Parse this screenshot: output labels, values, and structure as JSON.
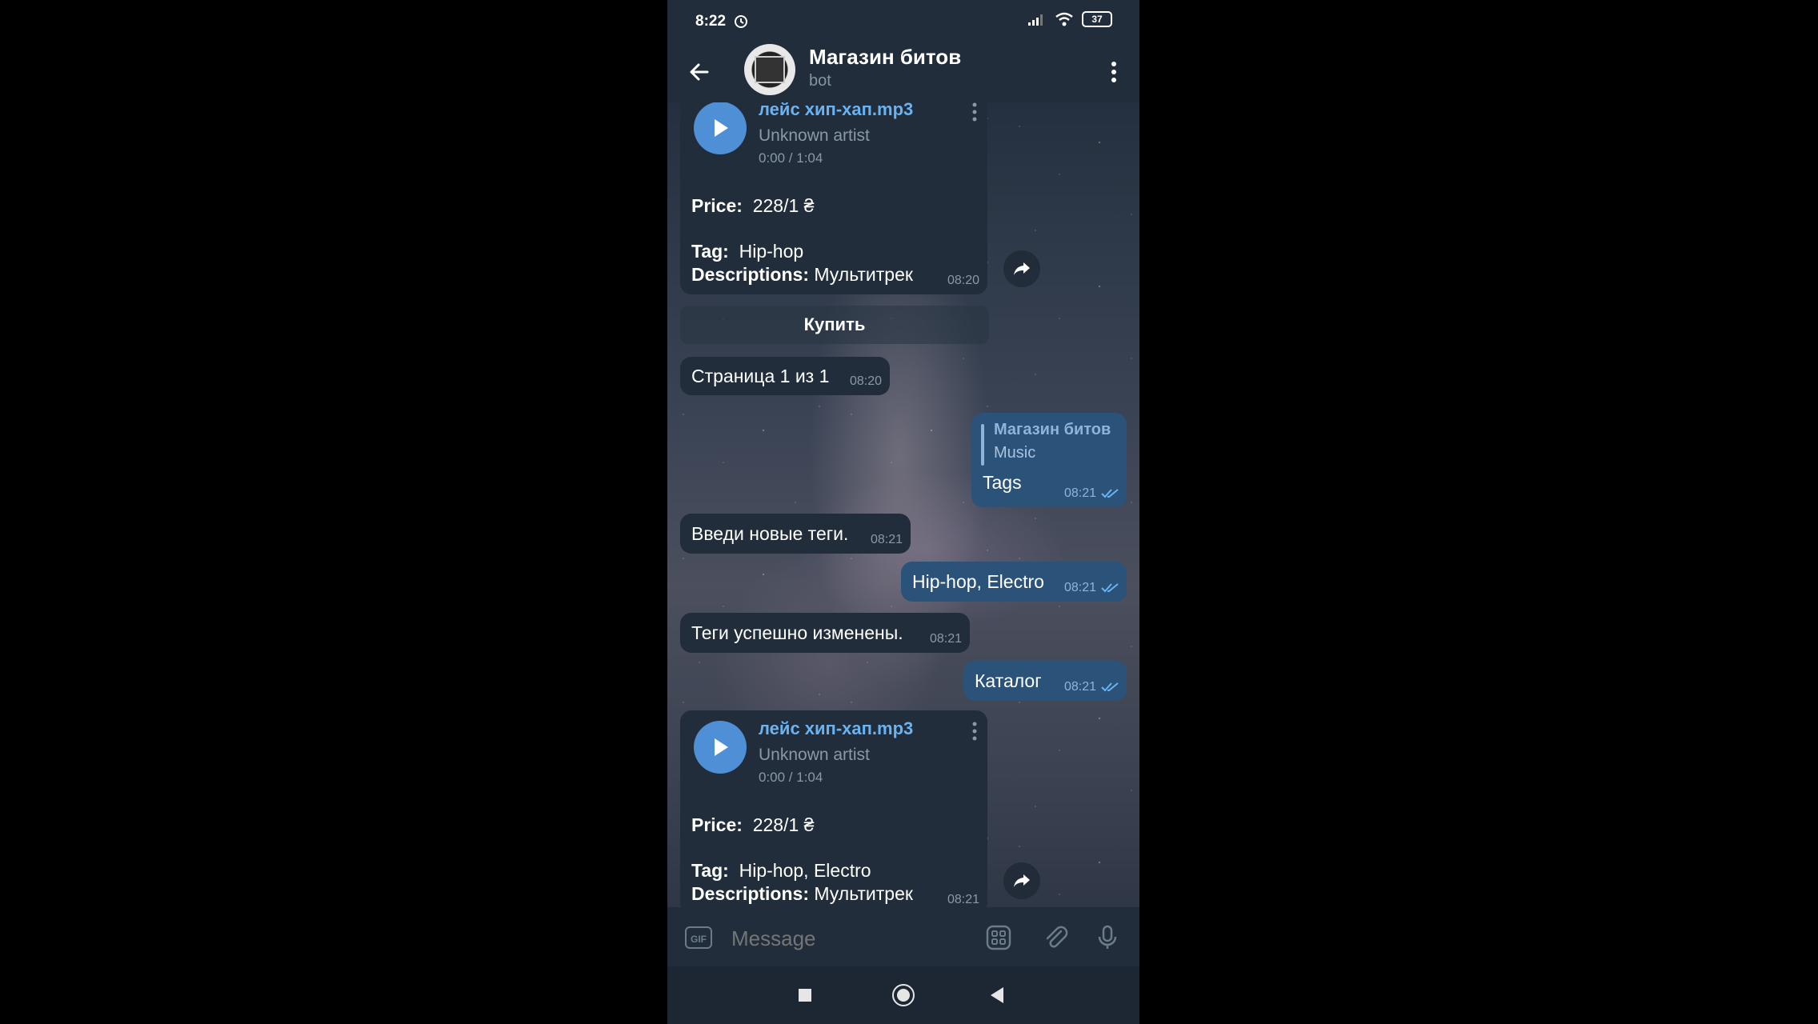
{
  "status": {
    "time": "8:22",
    "battery": "37"
  },
  "header": {
    "title": "Магазин битов",
    "subtitle": "bot"
  },
  "messages": {
    "audio1": {
      "filename": "лейс хип-хап.mp3",
      "artist": "Unknown artist",
      "duration": "0:00 / 1:04",
      "price_label": "Price:",
      "price_value": "228/1 ₴",
      "tag_label": "Tag:",
      "tag_value": "Hip-hop",
      "desc_label": "Descriptions:",
      "desc_value": "Мультитрек",
      "time": "08:20"
    },
    "buy_button": "Купить",
    "page_info": {
      "text": "Страница 1 из 1",
      "time": "08:20"
    },
    "tags_reply": {
      "reply_name": "Магазин битов",
      "reply_text": "Music",
      "text": "Tags",
      "time": "08:21"
    },
    "enter_tags": {
      "text": "Введи новые теги.",
      "time": "08:21"
    },
    "new_tags": {
      "text": "Hip-hop, Electro",
      "time": "08:21"
    },
    "tags_changed": {
      "text": "Теги успешно изменены.",
      "time": "08:21"
    },
    "catalog": {
      "text": "Каталог",
      "time": "08:21"
    },
    "audio2": {
      "filename": "лейс хип-хап.mp3",
      "artist": "Unknown artist",
      "duration": "0:00 / 1:04",
      "price_label": "Price:",
      "price_value": "228/1 ₴",
      "tag_label": "Tag:",
      "tag_value": "Hip-hop, Electro",
      "desc_label": "Descriptions:",
      "desc_value": "Мультитрек",
      "time": "08:21"
    }
  },
  "input": {
    "placeholder": "Message",
    "gif_label": "GIF"
  },
  "colors": {
    "accent": "#6ab3f3",
    "bubble_in": "#212d3b",
    "bubble_out": "#2b5278",
    "header": "#212d3b"
  },
  "icons": [
    "back-arrow-icon",
    "more-vert-icon",
    "play-icon",
    "share-icon",
    "gif-icon",
    "sticker-icon",
    "attach-icon",
    "mic-icon",
    "nav-recents-icon",
    "nav-home-icon",
    "nav-back-icon"
  ]
}
